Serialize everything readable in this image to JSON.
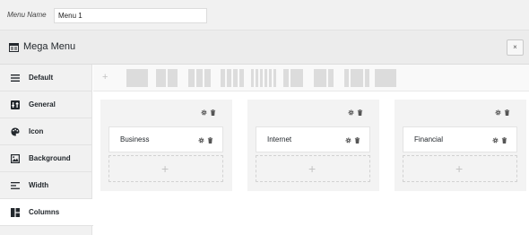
{
  "menu_name": {
    "label": "Menu Name",
    "value": "Menu 1"
  },
  "header": {
    "title": "Mega Menu",
    "title_icon": "mega-menu-icon",
    "close_label": "×"
  },
  "sidebar": {
    "items": [
      {
        "label": "Default",
        "icon": "hamburger-icon"
      },
      {
        "label": "General",
        "icon": "general-icon"
      },
      {
        "label": "Icon",
        "icon": "palette-icon"
      },
      {
        "label": "Background",
        "icon": "image-icon"
      },
      {
        "label": "Width",
        "icon": "width-icon"
      },
      {
        "label": "Columns",
        "icon": "columns-icon"
      }
    ],
    "active": "Columns"
  },
  "toolbar": {
    "add_label": "+"
  },
  "columns": [
    {
      "item_label": "Business",
      "add_label": "+"
    },
    {
      "item_label": "Internet",
      "add_label": "+"
    },
    {
      "item_label": "Financial",
      "add_label": "+"
    }
  ],
  "colors": {
    "accent_bg": "#f1f1f1",
    "border": "#e2e2e2",
    "text": "#23282d",
    "placeholder_block": "#dcdcdc"
  }
}
